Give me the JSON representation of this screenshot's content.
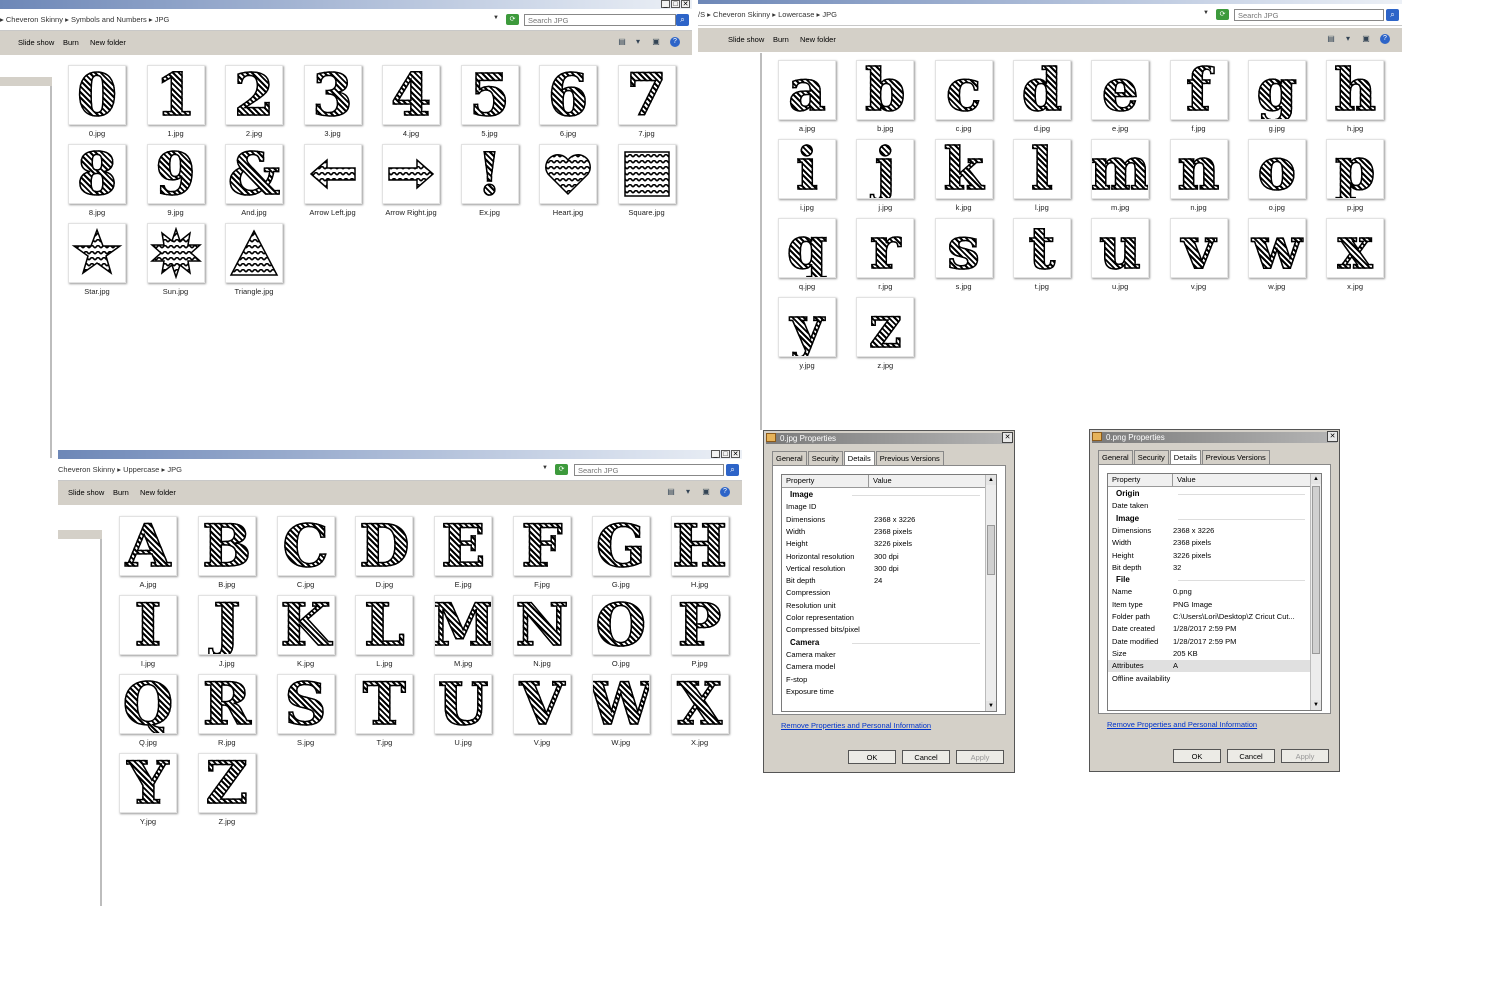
{
  "window_symbols": {
    "breadcrumb": [
      "Cheveron Skinny",
      "Symbols and Numbers",
      "JPG"
    ],
    "search_placeholder": "Search JPG",
    "toolbar": [
      "Slide show",
      "Burn",
      "New folder"
    ],
    "files": [
      {
        "name": "0.jpg",
        "glyph": "0"
      },
      {
        "name": "1.jpg",
        "glyph": "1"
      },
      {
        "name": "2.jpg",
        "glyph": "2"
      },
      {
        "name": "3.jpg",
        "glyph": "3"
      },
      {
        "name": "4.jpg",
        "glyph": "4"
      },
      {
        "name": "5.jpg",
        "glyph": "5"
      },
      {
        "name": "6.jpg",
        "glyph": "6"
      },
      {
        "name": "7.jpg",
        "glyph": "7"
      },
      {
        "name": "8.jpg",
        "glyph": "8"
      },
      {
        "name": "9.jpg",
        "glyph": "9"
      },
      {
        "name": "And.jpg",
        "glyph": "&"
      },
      {
        "name": "Arrow Left.jpg",
        "shape": "arrow-left"
      },
      {
        "name": "Arrow Right.jpg",
        "shape": "arrow-right"
      },
      {
        "name": "Ex.jpg",
        "glyph": "!"
      },
      {
        "name": "Heart.jpg",
        "shape": "heart"
      },
      {
        "name": "Square.jpg",
        "shape": "square"
      },
      {
        "name": "Star.jpg",
        "shape": "star"
      },
      {
        "name": "Sun.jpg",
        "shape": "sun"
      },
      {
        "name": "Triangle.jpg",
        "shape": "triangle"
      }
    ]
  },
  "window_lower": {
    "breadcrumb": [
      "Cheveron Skinny",
      "Lowercase",
      "JPG"
    ],
    "search_placeholder": "Search JPG",
    "toolbar": [
      "Slide show",
      "Burn",
      "New folder"
    ],
    "files": [
      {
        "name": "a.jpg",
        "glyph": "a"
      },
      {
        "name": "b.jpg",
        "glyph": "b"
      },
      {
        "name": "c.jpg",
        "glyph": "c"
      },
      {
        "name": "d.jpg",
        "glyph": "d"
      },
      {
        "name": "e.jpg",
        "glyph": "e"
      },
      {
        "name": "f.jpg",
        "glyph": "f"
      },
      {
        "name": "g.jpg",
        "glyph": "g"
      },
      {
        "name": "h.jpg",
        "glyph": "h"
      },
      {
        "name": "i.jpg",
        "glyph": "i"
      },
      {
        "name": "j.jpg",
        "glyph": "j"
      },
      {
        "name": "k.jpg",
        "glyph": "k"
      },
      {
        "name": "l.jpg",
        "glyph": "l"
      },
      {
        "name": "m.jpg",
        "glyph": "m"
      },
      {
        "name": "n.jpg",
        "glyph": "n"
      },
      {
        "name": "o.jpg",
        "glyph": "o"
      },
      {
        "name": "p.jpg",
        "glyph": "p"
      },
      {
        "name": "q.jpg",
        "glyph": "q"
      },
      {
        "name": "r.jpg",
        "glyph": "r"
      },
      {
        "name": "s.jpg",
        "glyph": "s"
      },
      {
        "name": "t.jpg",
        "glyph": "t"
      },
      {
        "name": "u.jpg",
        "glyph": "u"
      },
      {
        "name": "v.jpg",
        "glyph": "v"
      },
      {
        "name": "w.jpg",
        "glyph": "w"
      },
      {
        "name": "x.jpg",
        "glyph": "x"
      },
      {
        "name": "y.jpg",
        "glyph": "y"
      },
      {
        "name": "z.jpg",
        "glyph": "z"
      }
    ]
  },
  "window_upper": {
    "breadcrumb": [
      "Cheveron Skinny",
      "Uppercase",
      "JPG"
    ],
    "search_placeholder": "Search JPG",
    "toolbar": [
      "Slide show",
      "Burn",
      "New folder"
    ],
    "files": [
      {
        "name": "A.jpg",
        "glyph": "A"
      },
      {
        "name": "B.jpg",
        "glyph": "B"
      },
      {
        "name": "C.jpg",
        "glyph": "C"
      },
      {
        "name": "D.jpg",
        "glyph": "D"
      },
      {
        "name": "E.jpg",
        "glyph": "E"
      },
      {
        "name": "F.jpg",
        "glyph": "F"
      },
      {
        "name": "G.jpg",
        "glyph": "G"
      },
      {
        "name": "H.jpg",
        "glyph": "H"
      },
      {
        "name": "I.jpg",
        "glyph": "I"
      },
      {
        "name": "J.jpg",
        "glyph": "J"
      },
      {
        "name": "K.jpg",
        "glyph": "K"
      },
      {
        "name": "L.jpg",
        "glyph": "L"
      },
      {
        "name": "M.jpg",
        "glyph": "M"
      },
      {
        "name": "N.jpg",
        "glyph": "N"
      },
      {
        "name": "O.jpg",
        "glyph": "O"
      },
      {
        "name": "P.jpg",
        "glyph": "P"
      },
      {
        "name": "Q.jpg",
        "glyph": "Q"
      },
      {
        "name": "R.jpg",
        "glyph": "R"
      },
      {
        "name": "S.jpg",
        "glyph": "S"
      },
      {
        "name": "T.jpg",
        "glyph": "T"
      },
      {
        "name": "U.jpg",
        "glyph": "U"
      },
      {
        "name": "V.jpg",
        "glyph": "V"
      },
      {
        "name": "W.jpg",
        "glyph": "W"
      },
      {
        "name": "X.jpg",
        "glyph": "X"
      },
      {
        "name": "Y.jpg",
        "glyph": "Y"
      },
      {
        "name": "Z.jpg",
        "glyph": "Z"
      }
    ]
  },
  "dialog_jpg": {
    "title": "0.jpg Properties",
    "tabs": [
      "General",
      "Security",
      "Details",
      "Previous Versions"
    ],
    "active_tab": "Details",
    "columns": [
      "Property",
      "Value"
    ],
    "rows": [
      {
        "k": "Image",
        "section": true
      },
      {
        "k": "Image ID",
        "v": ""
      },
      {
        "k": "Dimensions",
        "v": "2368 x 3226"
      },
      {
        "k": "Width",
        "v": "2368 pixels"
      },
      {
        "k": "Height",
        "v": "3226 pixels"
      },
      {
        "k": "Horizontal resolution",
        "v": "300 dpi"
      },
      {
        "k": "Vertical resolution",
        "v": "300 dpi"
      },
      {
        "k": "Bit depth",
        "v": "24"
      },
      {
        "k": "Compression",
        "v": ""
      },
      {
        "k": "Resolution unit",
        "v": ""
      },
      {
        "k": "Color representation",
        "v": ""
      },
      {
        "k": "Compressed bits/pixel",
        "v": ""
      },
      {
        "k": "Camera",
        "section": true
      },
      {
        "k": "Camera maker",
        "v": ""
      },
      {
        "k": "Camera model",
        "v": ""
      },
      {
        "k": "F-stop",
        "v": ""
      },
      {
        "k": "Exposure time",
        "v": ""
      }
    ],
    "link": "Remove Properties and Personal Information",
    "buttons": [
      "OK",
      "Cancel",
      "Apply"
    ]
  },
  "dialog_png": {
    "title": "0.png Properties",
    "tabs": [
      "General",
      "Security",
      "Details",
      "Previous Versions"
    ],
    "active_tab": "Details",
    "columns": [
      "Property",
      "Value"
    ],
    "rows": [
      {
        "k": "Origin",
        "section": true
      },
      {
        "k": "Date taken",
        "v": ""
      },
      {
        "k": "Image",
        "section": true
      },
      {
        "k": "Dimensions",
        "v": "2368 x 3226"
      },
      {
        "k": "Width",
        "v": "2368 pixels"
      },
      {
        "k": "Height",
        "v": "3226 pixels"
      },
      {
        "k": "Bit depth",
        "v": "32"
      },
      {
        "k": "File",
        "section": true
      },
      {
        "k": "Name",
        "v": "0.png"
      },
      {
        "k": "Item type",
        "v": "PNG Image"
      },
      {
        "k": "Folder path",
        "v": "C:\\Users\\Lori\\Desktop\\Z Cricut Cut..."
      },
      {
        "k": "Date created",
        "v": "1/28/2017 2:59 PM"
      },
      {
        "k": "Date modified",
        "v": "1/28/2017 2:59 PM"
      },
      {
        "k": "Size",
        "v": "205 KB"
      },
      {
        "k": "Attributes",
        "v": "A",
        "selected": true
      },
      {
        "k": "Offline availability",
        "v": ""
      }
    ],
    "link": "Remove Properties and Personal Information",
    "buttons": [
      "OK",
      "Cancel",
      "Apply"
    ]
  }
}
